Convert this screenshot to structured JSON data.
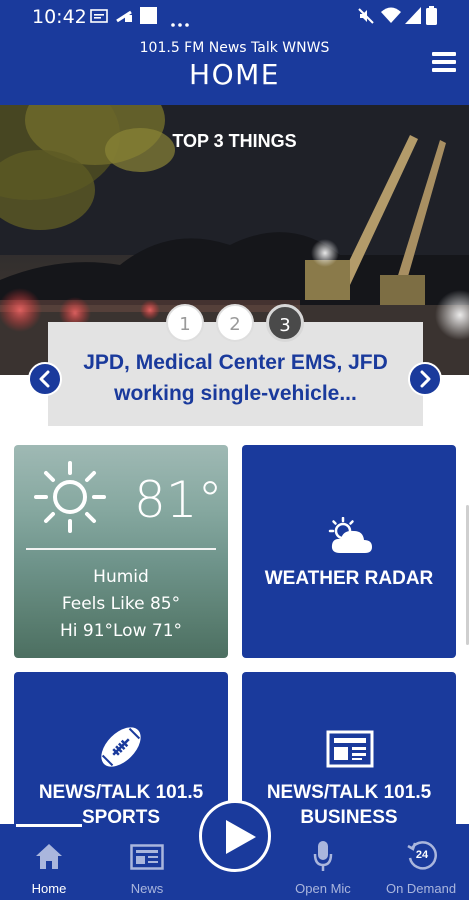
{
  "status_bar": {
    "time": "10:42",
    "icons": [
      "sms-icon",
      "cast-icon",
      "image-icon",
      "more-icon",
      "mute-icon",
      "wifi-icon",
      "signal-icon",
      "battery-icon"
    ]
  },
  "header": {
    "station": "101.5 FM News Talk  WNWS",
    "title": "HOME"
  },
  "carousel": {
    "title": "TOP 3 THINGS",
    "pages": [
      "1",
      "2",
      "3"
    ],
    "active_page": 3,
    "headline": "JPD, Medical Center EMS, JFD working single-vehicle..."
  },
  "weather": {
    "temperature": "81°",
    "condition": "Humid",
    "feels_like": "Feels Like 85°",
    "hi_low": "Hi 91°Low 71°"
  },
  "tiles": {
    "radar_label": "WEATHER RADAR",
    "sports_label": "NEWS/TALK 101.5 SPORTS",
    "business_label": "NEWS/TALK 101.5 BUSINESS"
  },
  "bottom_nav": {
    "home": "Home",
    "news": "News",
    "open_mic": "Open Mic",
    "on_demand": "On Demand",
    "on_demand_badge": "24"
  },
  "colors": {
    "brand_blue": "#1a3a9c",
    "headline_box": "#e3e3e3"
  }
}
